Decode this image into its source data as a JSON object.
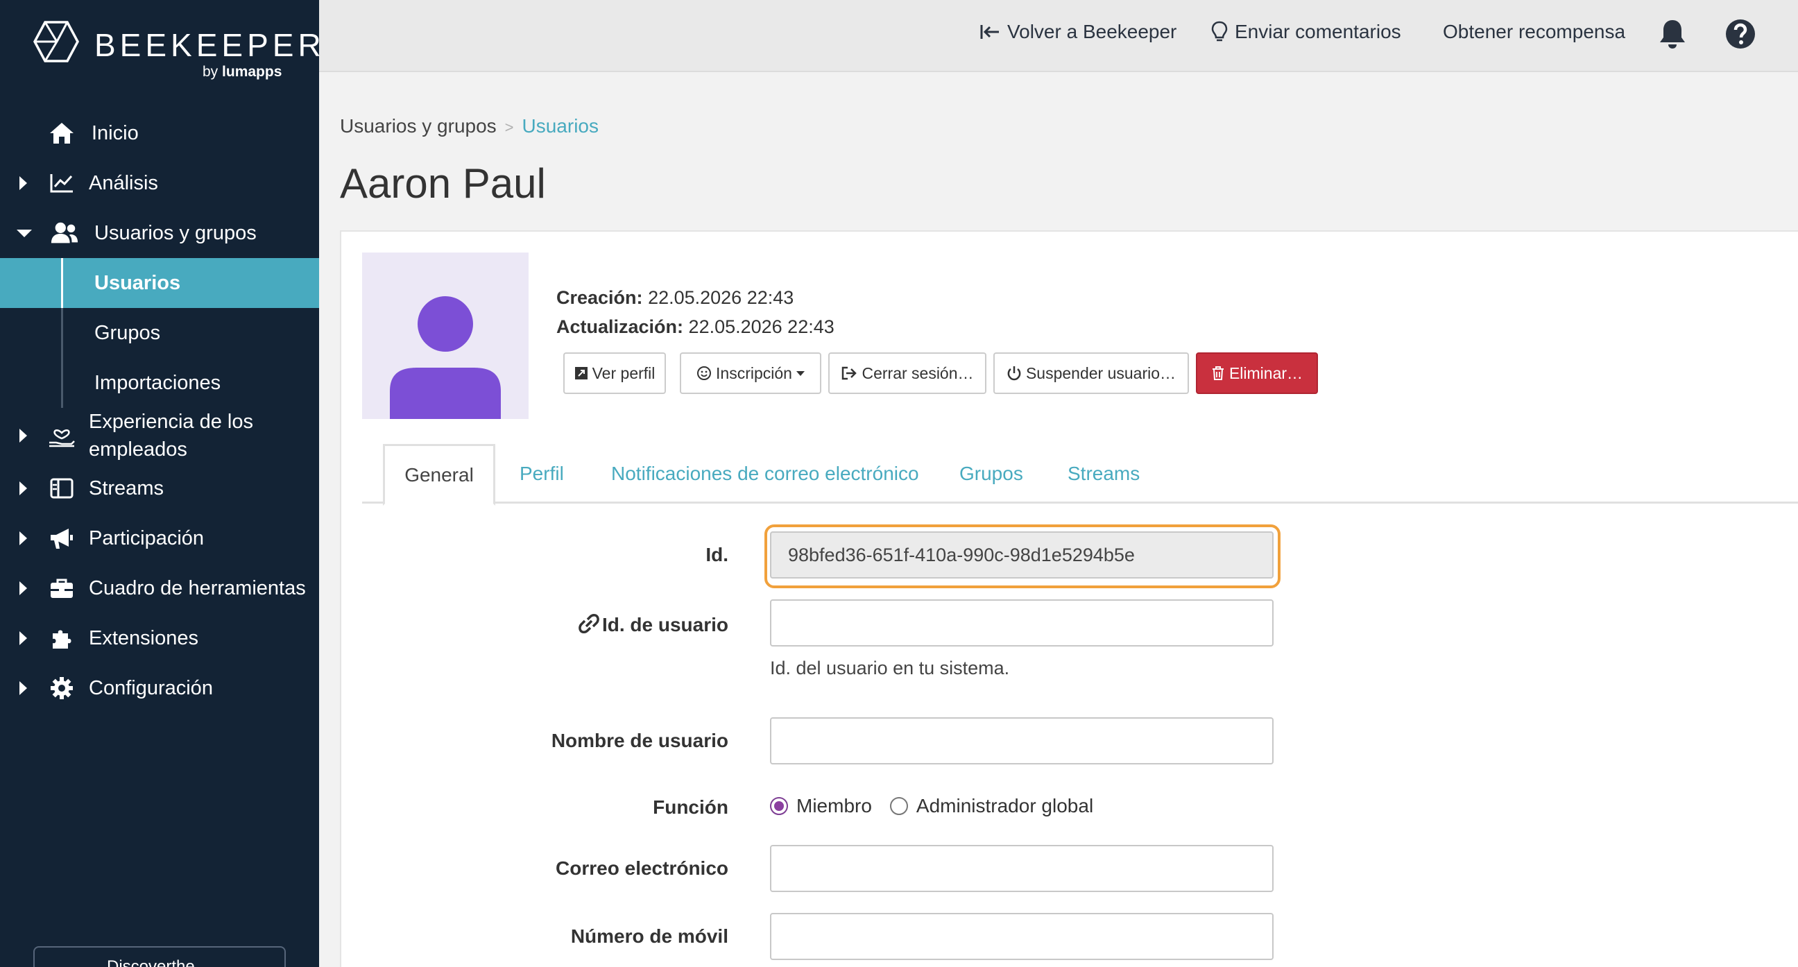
{
  "brand": {
    "name": "BEEKEEPER",
    "sub_prefix": "by",
    "sub_brand": "lumapps"
  },
  "sidebar": {
    "items": [
      {
        "label": "Inicio",
        "icon": "home-icon"
      },
      {
        "label": "Análisis",
        "icon": "chart-line-icon"
      },
      {
        "label": "Usuarios y grupos",
        "icon": "users-icon",
        "expanded": true,
        "children": [
          {
            "label": "Usuarios",
            "active": true
          },
          {
            "label": "Grupos"
          },
          {
            "label": "Importaciones"
          }
        ]
      },
      {
        "label": "Experiencia de los empleados",
        "icon": "hand-heart-icon"
      },
      {
        "label": "Streams",
        "icon": "streams-icon"
      },
      {
        "label": "Participación",
        "icon": "megaphone-icon"
      },
      {
        "label": "Cuadro de herramientas",
        "icon": "toolbox-icon"
      },
      {
        "label": "Extensiones",
        "icon": "puzzle-icon"
      },
      {
        "label": "Configuración",
        "icon": "gear-icon"
      }
    ],
    "bottom_label": "Discoverthe"
  },
  "topbar": {
    "back_label": "Volver a Beekeeper",
    "feedback_label": "Enviar comentarios",
    "reward_label": "Obtener recompensa"
  },
  "breadcrumb": {
    "parent": "Usuarios y grupos",
    "separator": ">",
    "current": "Usuarios"
  },
  "page_title": "Aaron Paul",
  "user": {
    "created_label": "Creación:",
    "created_value": "22.05.2026 22:43",
    "updated_label": "Actualización:",
    "updated_value": "22.05.2026 22:43"
  },
  "actions": {
    "view_profile": "Ver perfil",
    "enrollment": "Inscripción",
    "logout": "Cerrar sesión…",
    "suspend": "Suspender usuario…",
    "delete": "Eliminar…"
  },
  "tabs": [
    "General",
    "Perfil",
    "Notificaciones de correo electrónico",
    "Grupos",
    "Streams"
  ],
  "form": {
    "id_label": "Id.",
    "id_value": "98bfed36-651f-410a-990c-98d1e5294b5e",
    "user_id_label": "Id. de usuario",
    "user_id_value": "",
    "user_id_help": "Id. del usuario en tu sistema.",
    "username_label": "Nombre de usuario",
    "username_value": "",
    "role_label": "Función",
    "role_options": [
      "Miembro",
      "Administrador global"
    ],
    "role_selected": "Miembro",
    "email_label": "Correo electrónico",
    "email_value": "",
    "mobile_label": "Número de móvil",
    "mobile_value": ""
  },
  "colors": {
    "sidebar_bg": "#132335",
    "accent": "#48aabf",
    "danger": "#c9303e",
    "focus": "#f1a13c",
    "avatar": "#7c4fd6"
  }
}
